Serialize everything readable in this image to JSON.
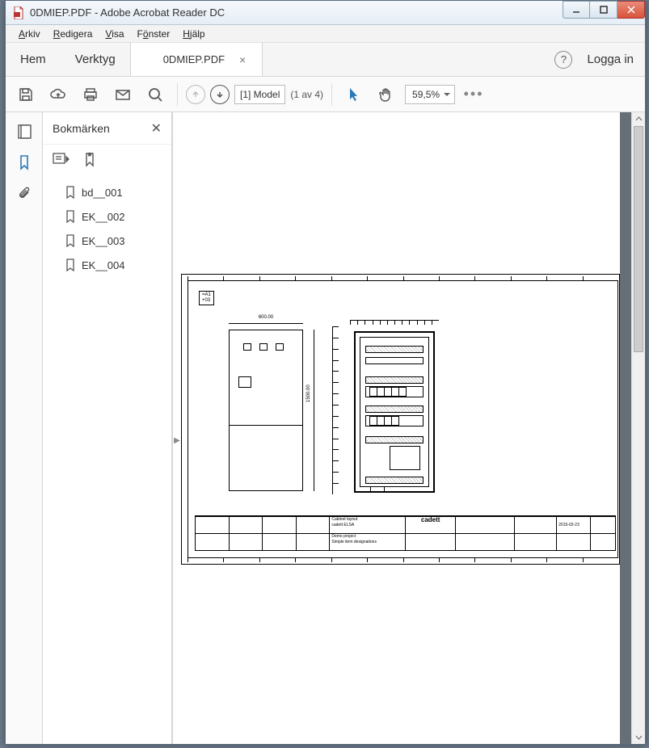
{
  "window": {
    "title": "0DMIEP.PDF - Adobe Acrobat Reader DC"
  },
  "menu": {
    "file": "Arkiv",
    "edit": "Redigera",
    "view": "Visa",
    "window": "Fönster",
    "help": "Hjälp"
  },
  "tabs": {
    "home": "Hem",
    "tools": "Verktyg",
    "doc": "0DMIEP.PDF",
    "signin": "Logga in"
  },
  "toolbar": {
    "page_label": "[1] Model",
    "page_count": "(1 av 4)",
    "zoom": "59,5%"
  },
  "bookmarks": {
    "title": "Bokmärken",
    "items": [
      "bd__001",
      "EK__002",
      "EK__003",
      "EK__004"
    ]
  },
  "drawing": {
    "tag1": "=A1",
    "tag2": "+03",
    "dim_width": "600.00",
    "dim_height": "1500.00",
    "titleblock": {
      "desc1": "Cabinet layout",
      "desc2": "cadett ELSA",
      "desc3": "Demo project",
      "desc4": "Simple item designations",
      "logo": "cadett",
      "date": "2015-02-23"
    }
  }
}
